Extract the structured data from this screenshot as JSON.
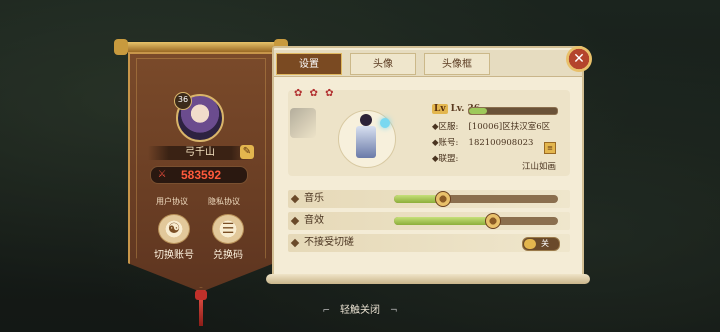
{
  "profile": {
    "level_badge": "36",
    "name": "弓千山",
    "power": "583592",
    "links": {
      "user_agreement": "用户协议",
      "privacy_policy": "隐私协议"
    },
    "actions": {
      "switch_account": "切换账号",
      "redeem_code": "兑换码"
    }
  },
  "tabs": [
    {
      "label": "设置",
      "active": true
    },
    {
      "label": "头像",
      "active": false
    },
    {
      "label": "头像框",
      "active": false
    }
  ],
  "character": {
    "level_label": "Lv. 36",
    "exp_fraction": 0.2,
    "server_label": "区服:",
    "server_value": "[10006]区扶汉室6区",
    "account_label": "账号:",
    "account_value": "182100908023",
    "guild_label": "联盟:",
    "guild_value": "江山如画"
  },
  "settings": {
    "music": {
      "label": "音乐",
      "level": 0.29
    },
    "sfx": {
      "label": "音效",
      "level": 0.6
    },
    "no_duel": {
      "label": "不接受切磋",
      "toggle_text": "关",
      "on": false
    }
  },
  "footer": {
    "tap_close": "轻触关闭"
  },
  "colors": {
    "accent_gold": "#e3b64e",
    "power_red": "#ff5a3c",
    "active_tab": "#7a4a22"
  },
  "icons": {
    "close": "close-icon",
    "edit": "pencil-icon",
    "power": "crossed-swords-icon",
    "copy": "copy-icon"
  }
}
